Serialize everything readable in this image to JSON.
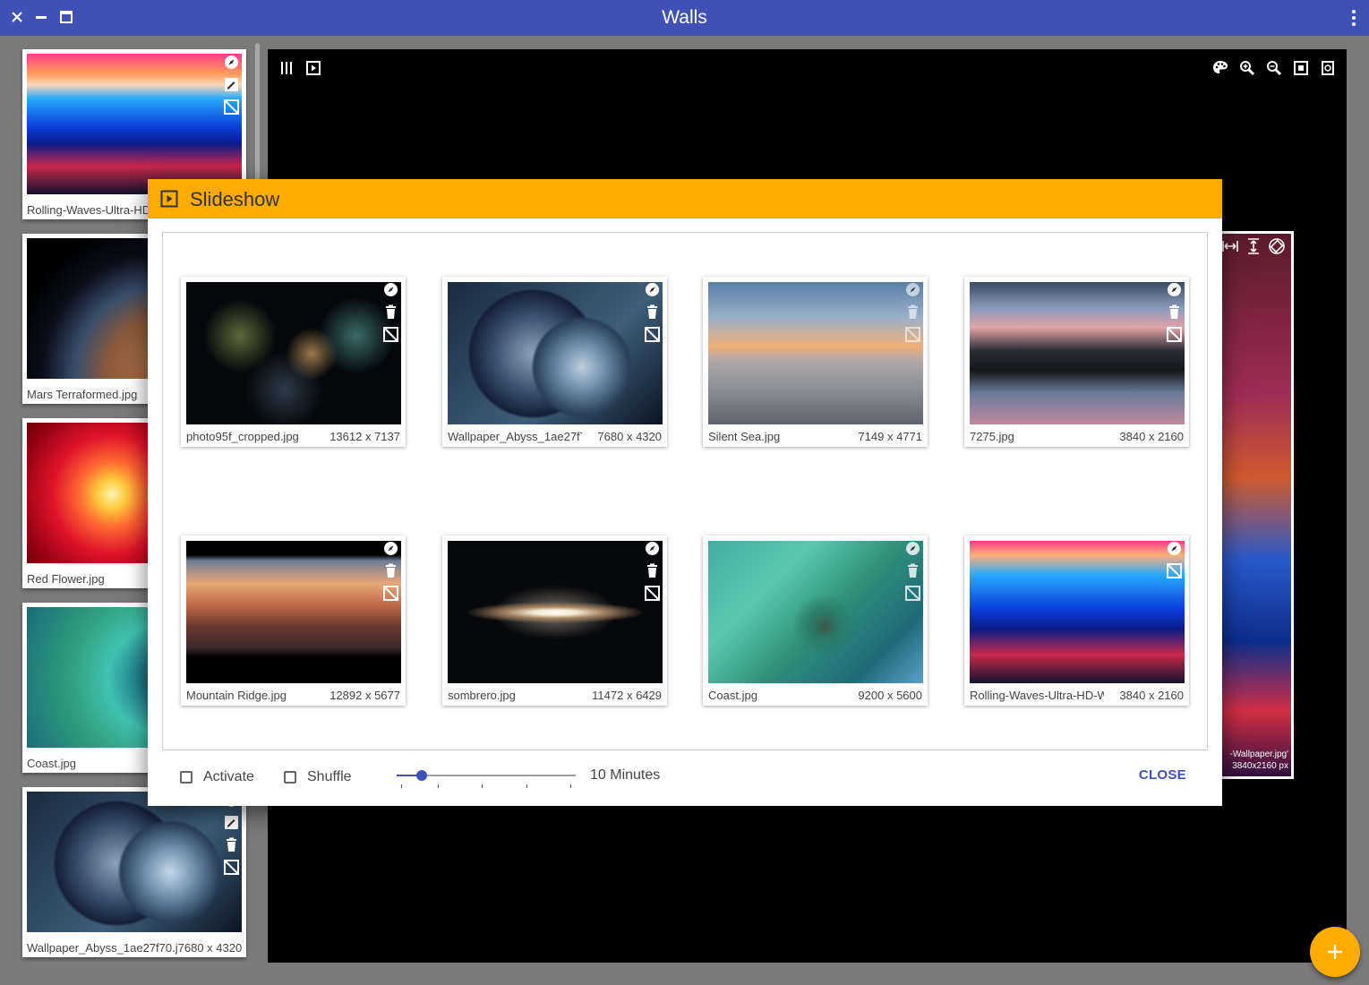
{
  "window": {
    "title": "Walls"
  },
  "sidebar": {
    "items": [
      {
        "name": "Rolling-Waves-Ultra-HD-Wallpaper.jpg",
        "dims": ""
      },
      {
        "name": "Mars Terraformed.jpg",
        "dims": ""
      },
      {
        "name": "Red Flower.jpg",
        "dims": ""
      },
      {
        "name": "Coast.jpg",
        "dims": ""
      },
      {
        "name": "Wallpaper_Abyss_1ae27f70.j",
        "dims": "7680 x 4320"
      }
    ]
  },
  "preview": {
    "caption_name": "-Wallpaper.jpg'",
    "caption_dims": "3840x2160 px"
  },
  "dialog": {
    "title": "Slideshow",
    "items": [
      {
        "name": "photo95f_cropped.jpg",
        "dims": "13612 x 7137"
      },
      {
        "name": "Wallpaper_Abyss_1ae27f70",
        "dims": "7680 x 4320"
      },
      {
        "name": "Silent Sea.jpg",
        "dims": "7149 x 4771"
      },
      {
        "name": "7275.jpg",
        "dims": "3840 x 2160"
      },
      {
        "name": "Mountain Ridge.jpg",
        "dims": "12892 x 5677"
      },
      {
        "name": "sombrero.jpg",
        "dims": "11472 x 6429"
      },
      {
        "name": "Coast.jpg",
        "dims": "9200 x 5600"
      },
      {
        "name": "Rolling-Waves-Ultra-HD-Wal",
        "dims": "3840 x 2160"
      }
    ],
    "activate_label": "Activate",
    "activate_checked": false,
    "shuffle_label": "Shuffle",
    "shuffle_checked": false,
    "interval_value": 0.14,
    "interval_label": "10 Minutes",
    "close_label": "CLOSE"
  },
  "colors": {
    "primary": "#3f51b5",
    "accent": "#ffab00"
  }
}
